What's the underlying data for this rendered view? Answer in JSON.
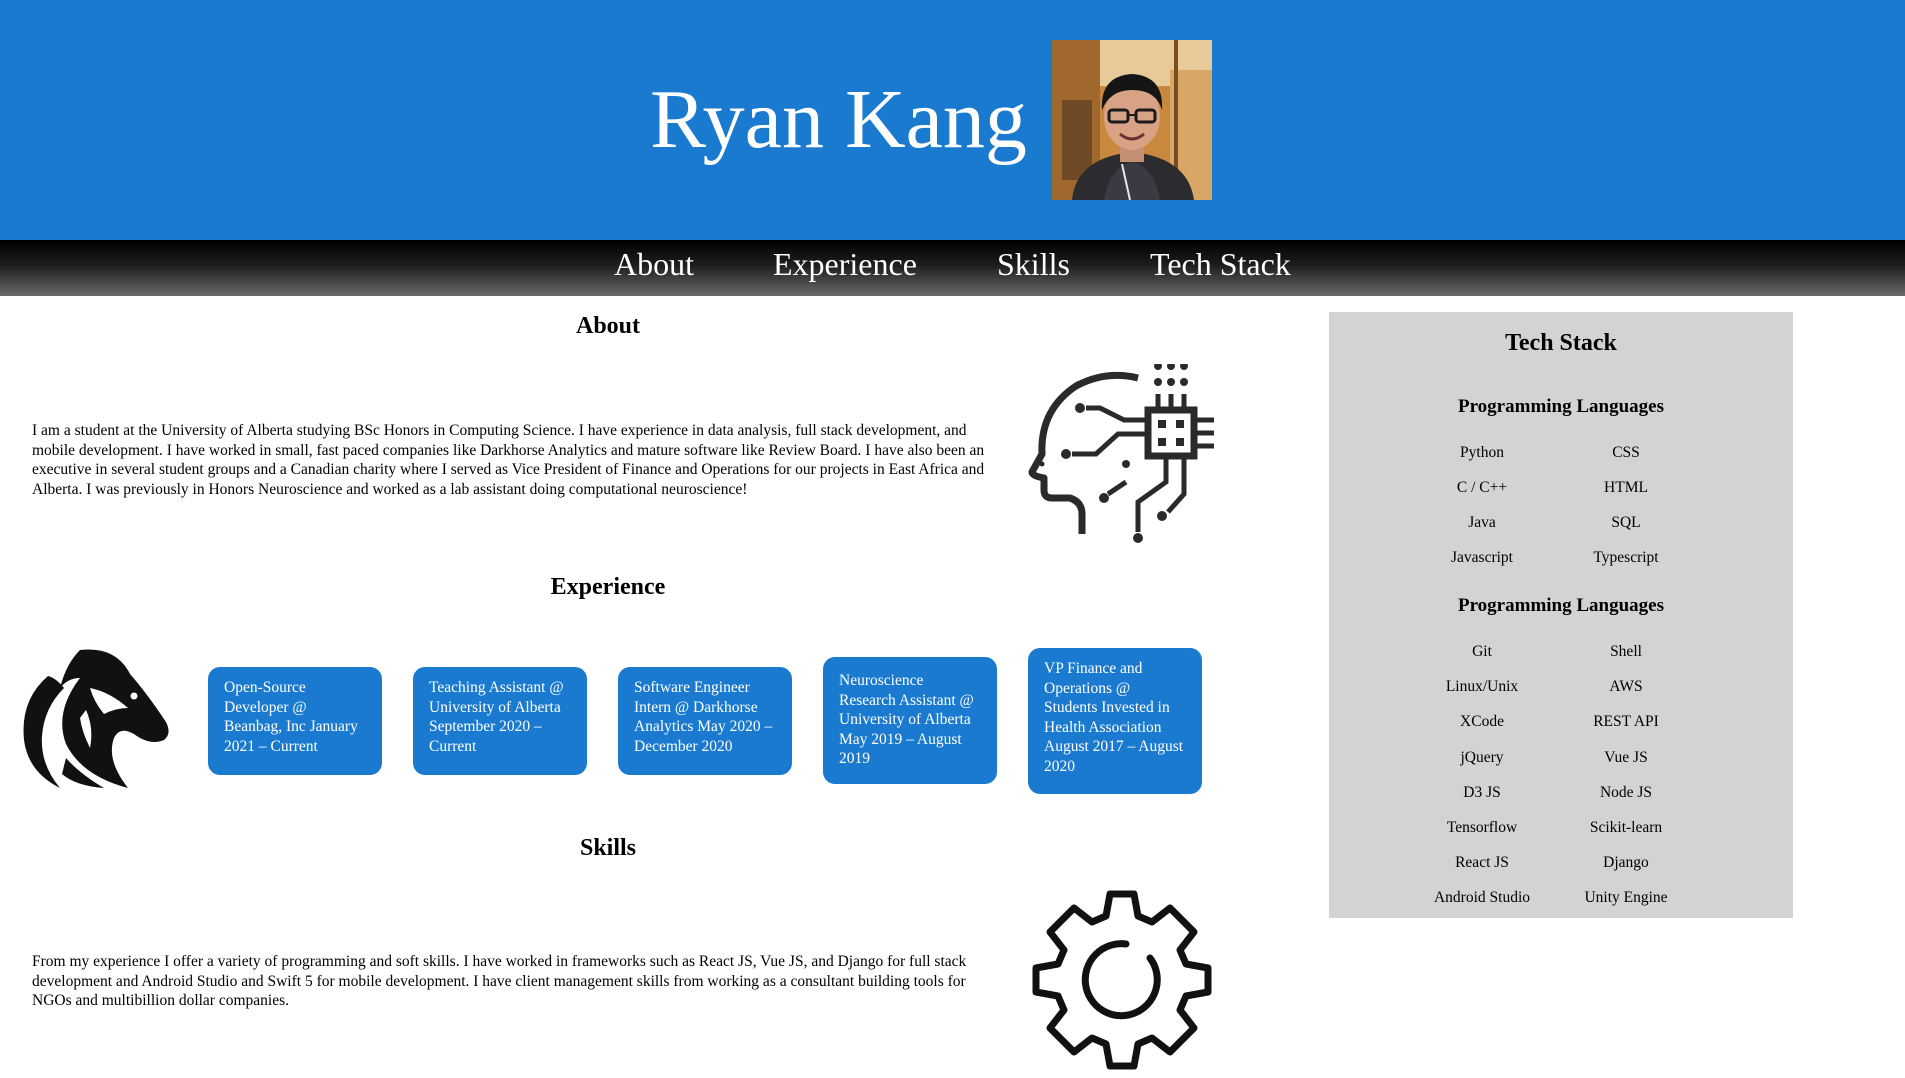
{
  "header": {
    "name": "Ryan Kang"
  },
  "nav": {
    "items": [
      "About",
      "Experience",
      "Skills",
      "Tech Stack"
    ]
  },
  "about": {
    "title": "About",
    "text": "I am a student at the University of Alberta studying BSc Honors in Computing Science. I have experience in data analysis, full stack development, and mobile development. I have worked in small, fast paced companies like Darkhorse Analytics and mature software like Review Board. I have also been an executive in several student groups and a Canadian charity where I served as Vice President of Finance and Operations for our projects in East Africa and Alberta. I was previously in Honors Neuroscience and worked as a lab assistant doing computational neuroscience!"
  },
  "experience": {
    "title": "Experience",
    "cards": [
      "Open-Source Developer @ Beanbag, Inc January 2021 – Current",
      "Teaching Assistant @ University of Alberta September 2020 – Current",
      "Software Engineer Intern @ Darkhorse Analytics May 2020 – December 2020",
      "Neuroscience Research Assistant @ University of Alberta May 2019 – August 2019",
      "VP Finance and Operations @ Students Invested in Health Association August 2017 – August 2020"
    ]
  },
  "skills": {
    "title": "Skills",
    "text": "From my experience I offer a variety of programming and soft skills. I have worked in frameworks such as React JS, Vue JS, and Django for full stack development and Android Studio and Swift 5 for mobile development. I have client management skills from working as a consultant building tools for NGOs and multibillion dollar companies."
  },
  "tech_stack": {
    "title": "Tech Stack",
    "groups": [
      {
        "title": "Programming Languages",
        "items": [
          "Python",
          "CSS",
          "C / C++",
          "HTML",
          "Java",
          "SQL",
          "Javascript",
          "Typescript"
        ]
      },
      {
        "title": "Programming Languages",
        "items": [
          "Git",
          "Shell",
          "Linux/Unix",
          "AWS",
          "XCode",
          "REST API",
          "jQuery",
          "Vue JS",
          "D3 JS",
          "Node JS",
          "Tensorflow",
          "Scikit-learn",
          "React JS",
          "Django",
          "Android Studio",
          "Unity Engine"
        ]
      }
    ]
  },
  "icons": {
    "profile_photo": "profile-photo",
    "brain_chip": "brain-chip-icon",
    "horse_logo": "horse-logo-icon",
    "gear": "gear-icon"
  },
  "colors": {
    "accent": "#1a7ad0",
    "sidebar_bg": "#d3d3d3",
    "nav_bg": "#000000"
  }
}
